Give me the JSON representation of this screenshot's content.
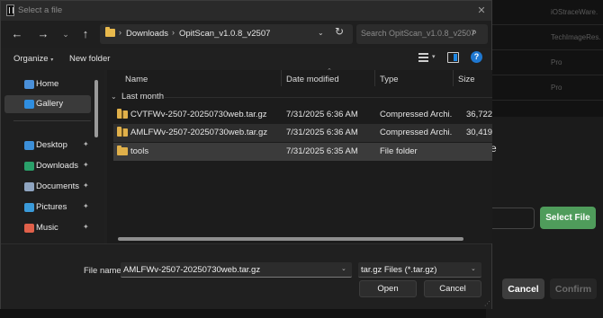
{
  "dialog": {
    "title": "Select a file",
    "close_glyph": "✕"
  },
  "nav": {
    "back_glyph": "←",
    "forward_glyph": "→",
    "recent_glyph": "⌄",
    "up_glyph": "↑",
    "breadcrumbs": [
      "Downloads",
      "OpitScan_v1.0.8_v2507"
    ],
    "crumb_sep": "›",
    "address_chevron": "⌄",
    "refresh_glyph": "↻",
    "search_placeholder": "Search OpitScan_v1.0.8_v2507",
    "search_glyph": "⌕"
  },
  "toolbar": {
    "organize_label": "Organize",
    "organize_chevron": "▾",
    "new_folder_label": "New folder",
    "view_chevron": "▾",
    "help_glyph": "?"
  },
  "sidebar": {
    "items": [
      {
        "label": "Home",
        "icon": "home-icon",
        "color": "#4a90d9"
      },
      {
        "label": "Gallery",
        "icon": "gallery-icon",
        "color": "#2f8ee0",
        "selected": true
      },
      {
        "label": "Desktop",
        "icon": "desktop-icon",
        "color": "#3c8fd8"
      },
      {
        "label": "Downloads",
        "icon": "download-icon",
        "color": "#2aa06a"
      },
      {
        "label": "Documents",
        "icon": "documents-icon",
        "color": "#8fa4c0"
      },
      {
        "label": "Pictures",
        "icon": "pictures-icon",
        "color": "#3a9ad9"
      },
      {
        "label": "Music",
        "icon": "music-icon",
        "color": "#e0604a"
      }
    ],
    "pin_glyph": "✦"
  },
  "list": {
    "columns": [
      "Name",
      "Date modified",
      "Type",
      "Size"
    ],
    "sort_glyph": "⌃",
    "group_label": "Last month",
    "group_chevron": "⌄",
    "rows": [
      {
        "name": "CVTFWv-2507-20250730web.tar.gz",
        "date": "7/31/2025 6:36 AM",
        "type": "Compressed Archi...",
        "size": "36,722",
        "kind": "zip"
      },
      {
        "name": "AMLFWv-2507-20250730web.tar.gz",
        "date": "7/31/2025 6:36 AM",
        "type": "Compressed Archi...",
        "size": "30,419",
        "kind": "zip"
      },
      {
        "name": "tools",
        "date": "7/31/2025 6:35 AM",
        "type": "File folder",
        "size": "",
        "kind": "folder"
      }
    ]
  },
  "footer": {
    "filename_label": "File name:",
    "filename_value": "AMLFWv-2507-20250730web.tar.gz",
    "filetype_value": "tar.gz Files (*.tar.gz)",
    "dropdown_glyph": "⌄",
    "open_label": "Open",
    "cancel_label": "Cancel",
    "grip_glyph": "⋰"
  },
  "background": {
    "rows": [
      "iOStraceWare.",
      "TechImageRes.",
      "Pro",
      "Pro"
    ],
    "e_text": "e",
    "select_file_label": "Select File",
    "cancel_label": "Cancel",
    "confirm_label": "Confirm",
    "accent": "#4f9c5b"
  }
}
